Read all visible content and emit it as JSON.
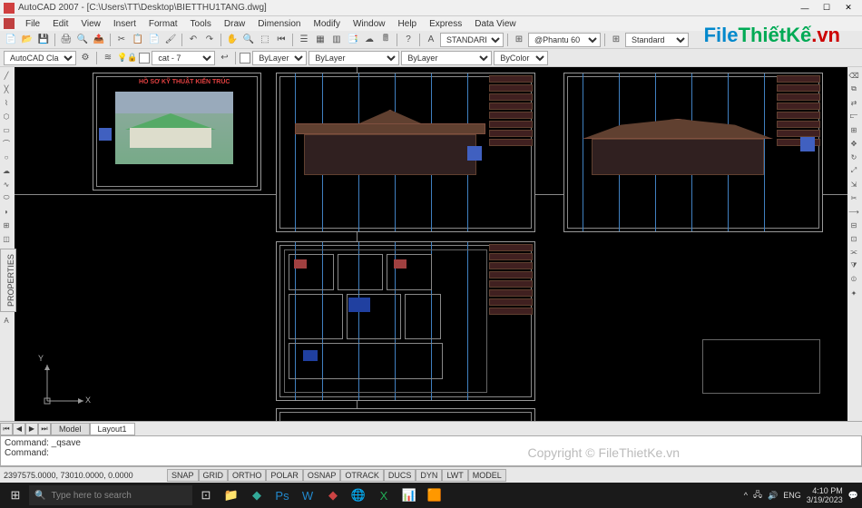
{
  "app": {
    "name": "AutoCAD 2007",
    "file_path": "[C:\\Users\\TT\\Desktop\\BIETTHU1TANG.dwg]",
    "win_min": "—",
    "win_max": "☐",
    "win_close": "✕"
  },
  "menu": [
    "File",
    "Edit",
    "View",
    "Insert",
    "Format",
    "Tools",
    "Draw",
    "Dimension",
    "Modify",
    "Window",
    "Help",
    "Express",
    "Data View"
  ],
  "toolbar1": {
    "style_combo": "STANDARD",
    "font_combo": "@Phantu 60",
    "dim_combo": "Standard"
  },
  "toolbar2": {
    "workspace": "AutoCAD Classic",
    "layer": "cat - 7",
    "lineweight": "ByLayer",
    "linetype": "ByLayer",
    "plot_style": "ByLayer",
    "color": "ByColor"
  },
  "logo": {
    "p1": "File",
    "p2": "ThiếtKế",
    "p3": ".vn"
  },
  "props_label": "PROPERTIES",
  "ucs": {
    "x": "X",
    "y": "Y"
  },
  "cover_title": "HỒ SƠ KỸ THUẬT KIẾN TRÚC",
  "layout_tabs": {
    "nav_first": "⏮",
    "nav_prev": "◀",
    "nav_next": "▶",
    "nav_last": "⏭",
    "model": "Model",
    "layout1": "Layout1"
  },
  "command": {
    "line1": "Command: _qsave",
    "line2": "Command:"
  },
  "watermark": "Copyright © FileThietKe.vn",
  "status": {
    "coords": "2397575.0000, 73010.0000, 0.0000",
    "snap_btns": [
      "SNAP",
      "GRID",
      "ORTHO",
      "POLAR",
      "OSNAP",
      "OTRACK",
      "DUCS",
      "DYN",
      "LWT",
      "MODEL"
    ]
  },
  "taskbar": {
    "search_placeholder": "Type here to search",
    "lang": "ENG",
    "time": "4:10 PM",
    "date": "3/19/2023"
  }
}
